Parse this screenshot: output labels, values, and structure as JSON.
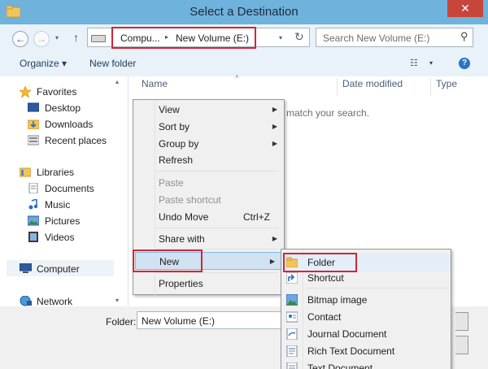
{
  "window": {
    "title": "Select a Destination",
    "close_glyph": "✕"
  },
  "nav": {
    "back_glyph": "←",
    "forward_glyph": "→",
    "history_glyph": "▾",
    "up_glyph": "↑"
  },
  "address": {
    "crumbs": [
      "Compu...",
      "New Volume (E:)"
    ],
    "separator_glyph": "▸",
    "dropdown_glyph": "▾",
    "refresh_glyph": "↻"
  },
  "search": {
    "placeholder": "Search New Volume (E:)",
    "icon_glyph": "⚲"
  },
  "toolbar": {
    "organize": "Organize ▾",
    "new_folder": "New folder",
    "view_glyph": "☷",
    "view_drop_glyph": "▾",
    "help_glyph": "?"
  },
  "sidebar": {
    "favorites": "Favorites",
    "favorites_items": [
      "Desktop",
      "Downloads",
      "Recent places"
    ],
    "libraries": "Libraries",
    "libraries_items": [
      "Documents",
      "Music",
      "Pictures",
      "Videos"
    ],
    "computer": "Computer",
    "network": "Network",
    "scroll_up_glyph": "▴",
    "scroll_down_glyph": "▾"
  },
  "columns": {
    "name": "Name",
    "date_modified": "Date modified",
    "type": "Type",
    "sort_glyph": "˄"
  },
  "empty_message": "match your search.",
  "footer": {
    "folder_label": "Folder:",
    "folder_value": "New Volume (E:)"
  },
  "context_menu": {
    "arrow_glyph": "▶",
    "items": {
      "view": "View",
      "sort_by": "Sort by",
      "group_by": "Group by",
      "refresh": "Refresh",
      "paste": "Paste",
      "paste_shortcut": "Paste shortcut",
      "undo_move": "Undo Move",
      "undo_shortcut": "Ctrl+Z",
      "share_with": "Share with",
      "new": "New",
      "properties": "Properties"
    }
  },
  "new_submenu": {
    "items": [
      "Folder",
      "Shortcut",
      "Bitmap image",
      "Contact",
      "Journal Document",
      "Rich Text Document",
      "Text Document"
    ]
  },
  "colors": {
    "titlebar": "#6fb2dc",
    "highlight": "#d32536",
    "close": "#c7453a"
  }
}
